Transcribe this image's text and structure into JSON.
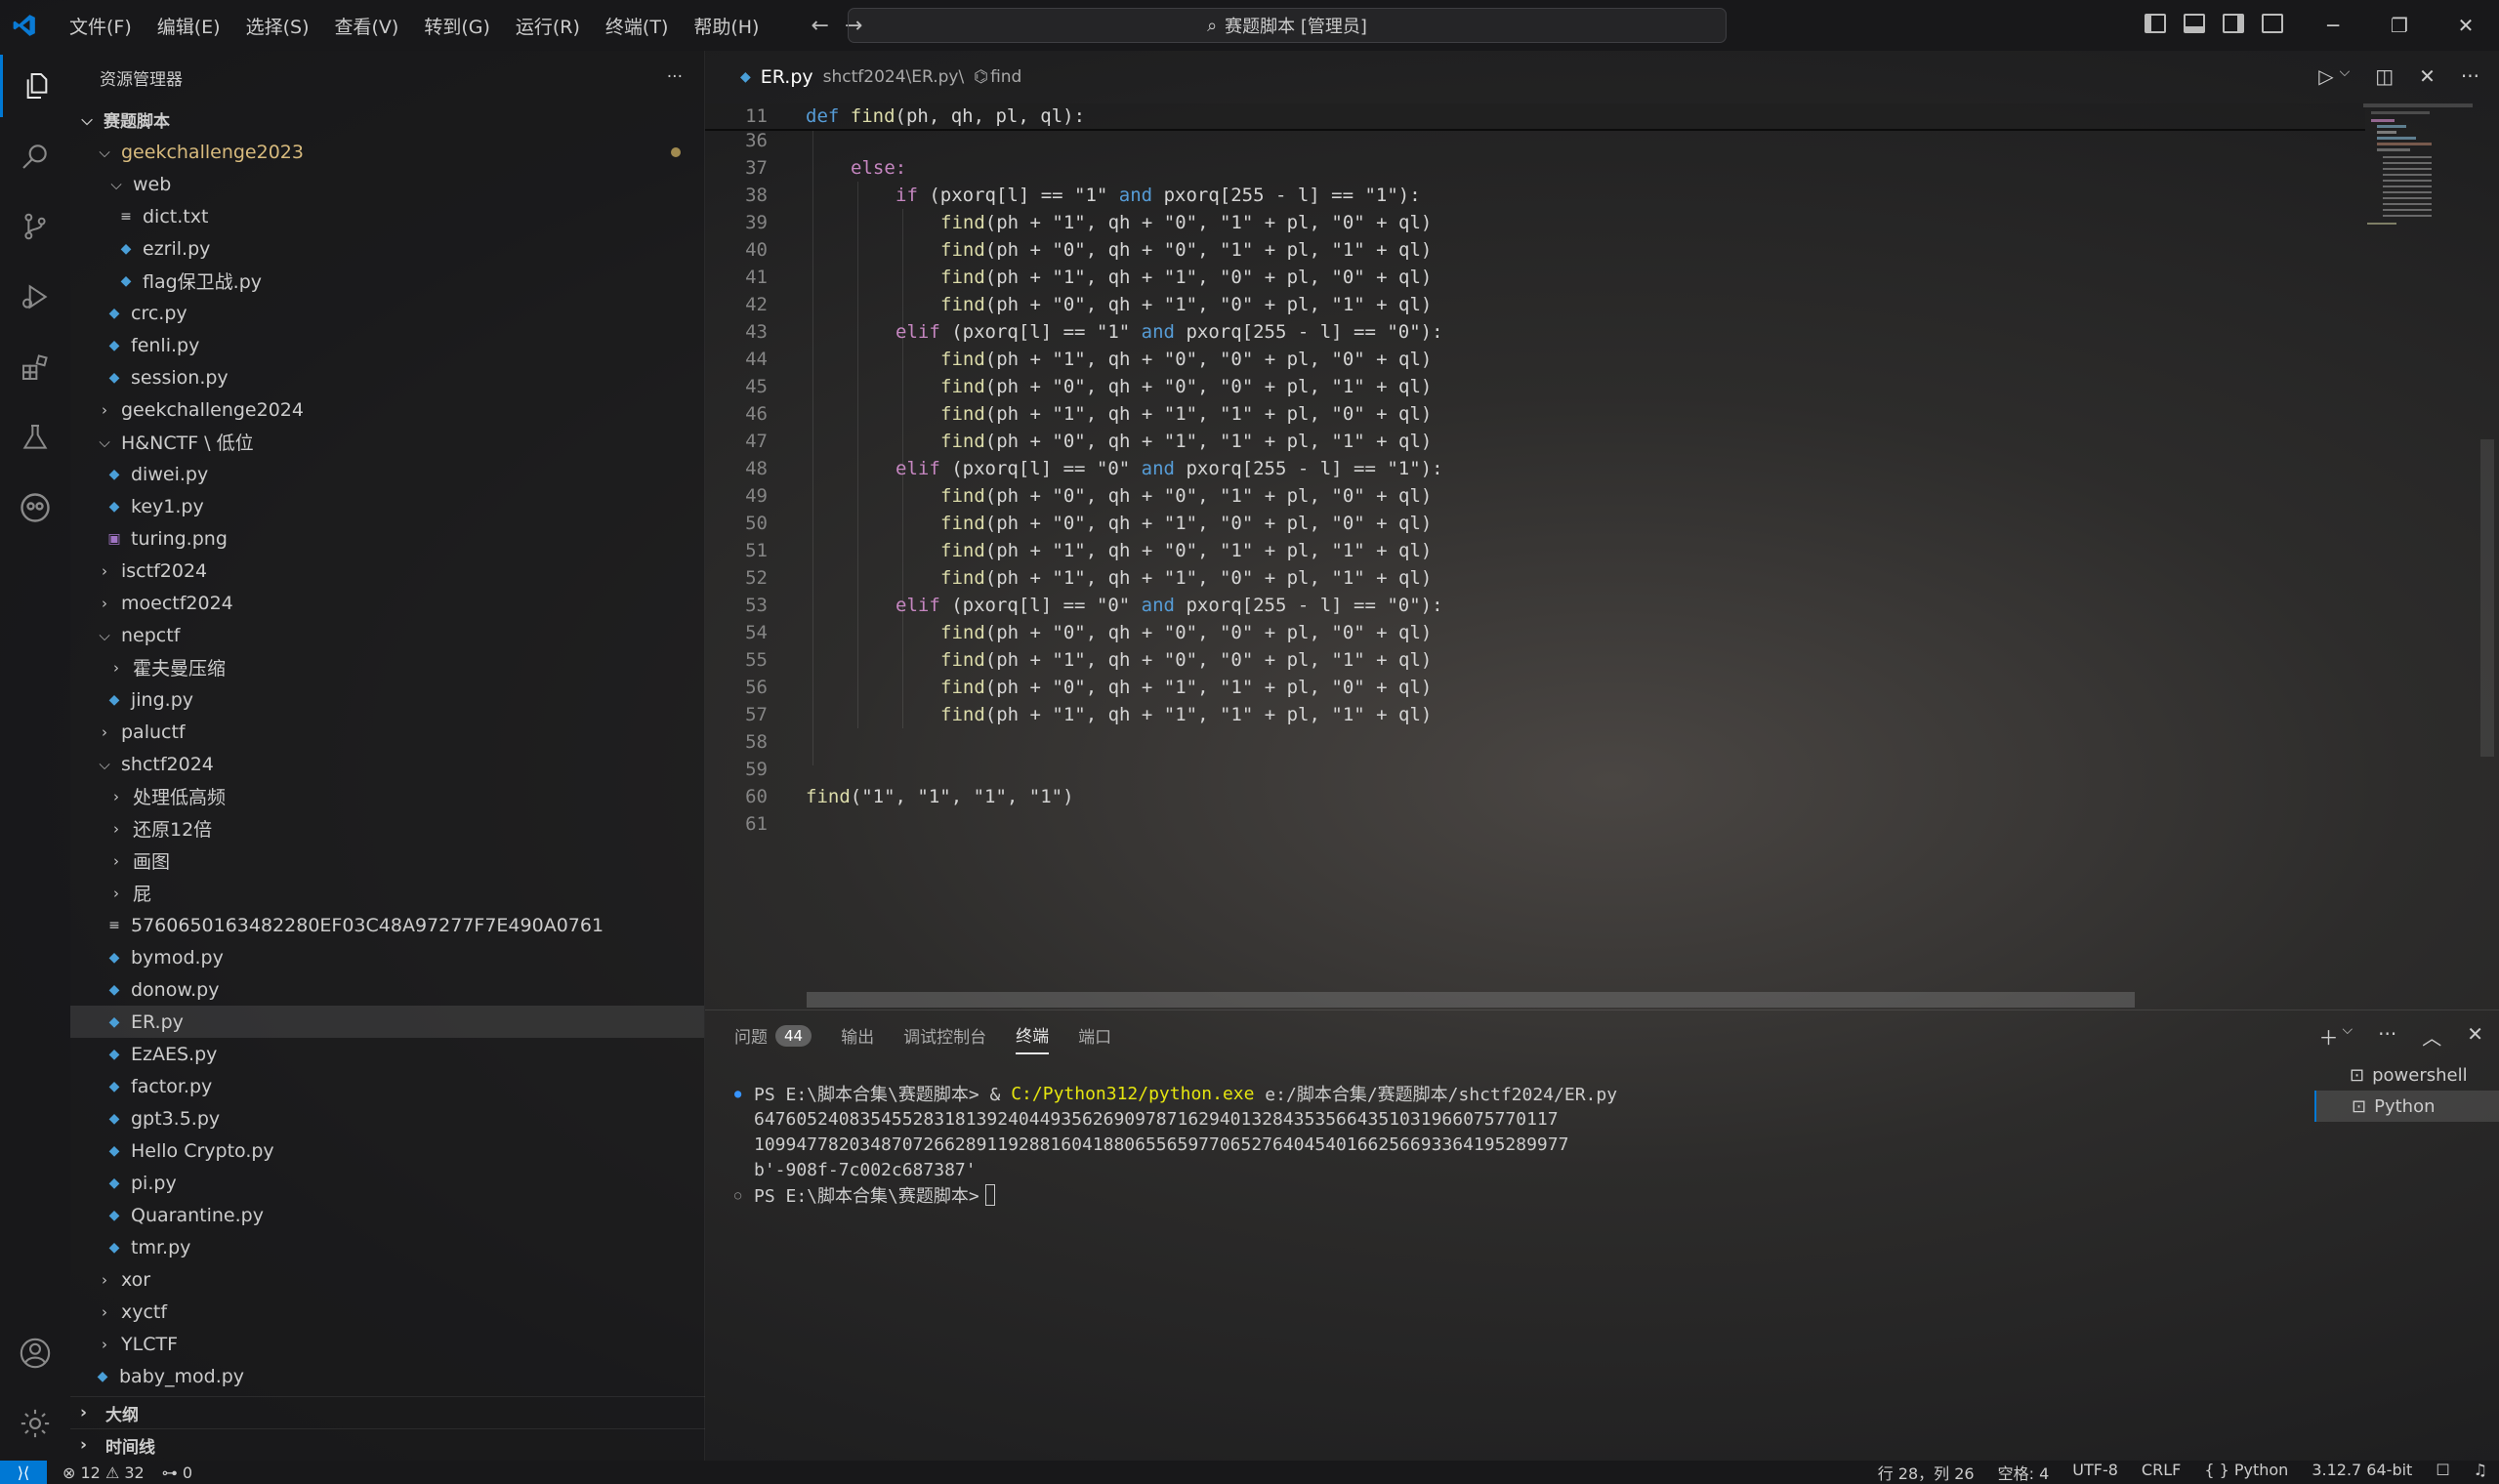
{
  "titlebar": {
    "menu": [
      "文件(F)",
      "编辑(E)",
      "选择(S)",
      "查看(V)",
      "转到(G)",
      "运行(R)",
      "终端(T)",
      "帮助(H)"
    ],
    "search_text": "赛题脚本 [管理员]"
  },
  "sidebar": {
    "title": "资源管理器",
    "more": "···",
    "root": "赛题脚本",
    "items": [
      {
        "label": "geekchallenge2023"
      },
      {
        "label": "web"
      },
      {
        "label": "dict.txt"
      },
      {
        "label": "ezril.py"
      },
      {
        "label": "flag保卫战.py"
      },
      {
        "label": "crc.py"
      },
      {
        "label": "fenli.py"
      },
      {
        "label": "session.py"
      },
      {
        "label": "geekchallenge2024"
      },
      {
        "label": "H&NCTF \\ 低位"
      },
      {
        "label": "diwei.py"
      },
      {
        "label": "key1.py"
      },
      {
        "label": "turing.png"
      },
      {
        "label": "isctf2024"
      },
      {
        "label": "moectf2024"
      },
      {
        "label": "nepctf"
      },
      {
        "label": "霍夫曼压缩"
      },
      {
        "label": "jing.py"
      },
      {
        "label": "paluctf"
      },
      {
        "label": "shctf2024"
      },
      {
        "label": "处理低高频"
      },
      {
        "label": "还原12倍"
      },
      {
        "label": "画图"
      },
      {
        "label": "屁"
      },
      {
        "label": "5760650163482280EF03C48A97277F7E490A0761"
      },
      {
        "label": "bymod.py"
      },
      {
        "label": "donow.py"
      },
      {
        "label": "ER.py"
      },
      {
        "label": "EzAES.py"
      },
      {
        "label": "factor.py"
      },
      {
        "label": "gpt3.5.py"
      },
      {
        "label": "Hello Crypto.py"
      },
      {
        "label": "pi.py"
      },
      {
        "label": "Quarantine.py"
      },
      {
        "label": "tmr.py"
      },
      {
        "label": "xor"
      },
      {
        "label": "xyctf"
      },
      {
        "label": "YLCTF"
      },
      {
        "label": "baby_mod.py"
      }
    ],
    "outline": "大纲",
    "timeline": "时间线"
  },
  "editor": {
    "tab_name": "ER.py",
    "breadcrumb_path": "shctf2024\\ER.py\\",
    "breadcrumb_symbol": "find",
    "line_numbers": [
      "11",
      "36",
      "37",
      "38",
      "39",
      "40",
      "41",
      "42",
      "43",
      "44",
      "45",
      "46",
      "47",
      "48",
      "49",
      "50",
      "51",
      "52",
      "53",
      "54",
      "55",
      "56",
      "57",
      "58",
      "59",
      "60",
      "61"
    ],
    "code": {
      "l11_def": "def",
      "l11_name": "find",
      "l11_params": "(ph, qh, pl, ql):",
      "l37": "else:",
      "l38_kw": "if",
      "l38_a": " (pxorq[l] == \"1\" ",
      "l38_and": "and",
      "l38_b": " pxorq[255 - l] == \"1\"):",
      "l43_kw": "elif",
      "l43_a": " (pxorq[l] == \"1\" ",
      "l43_and": "and",
      "l43_b": " pxorq[255 - l] == \"0\"):",
      "l48_kw": "elif",
      "l48_a": " (pxorq[l] == \"0\" ",
      "l48_and": "and",
      "l48_b": " pxorq[255 - l] == \"1\"):",
      "l53_kw": "elif",
      "l53_a": " (pxorq[l] == \"0\" ",
      "l53_and": "and",
      "l53_b": " pxorq[255 - l] == \"0\"):",
      "calls": [
        "(ph + \"1\", qh + \"0\", \"1\" + pl, \"0\" + ql)",
        "(ph + \"0\", qh + \"0\", \"1\" + pl, \"1\" + ql)",
        "(ph + \"1\", qh + \"1\", \"0\" + pl, \"0\" + ql)",
        "(ph + \"0\", qh + \"1\", \"0\" + pl, \"1\" + ql)",
        "(ph + \"1\", qh + \"0\", \"0\" + pl, \"0\" + ql)",
        "(ph + \"0\", qh + \"0\", \"0\" + pl, \"1\" + ql)",
        "(ph + \"1\", qh + \"1\", \"1\" + pl, \"0\" + ql)",
        "(ph + \"0\", qh + \"1\", \"1\" + pl, \"1\" + ql)",
        "(ph + \"0\", qh + \"0\", \"1\" + pl, \"0\" + ql)",
        "(ph + \"0\", qh + \"1\", \"0\" + pl, \"0\" + ql)",
        "(ph + \"1\", qh + \"0\", \"1\" + pl, \"1\" + ql)",
        "(ph + \"1\", qh + \"1\", \"0\" + pl, \"1\" + ql)",
        "(ph + \"0\", qh + \"0\", \"0\" + pl, \"0\" + ql)",
        "(ph + \"1\", qh + \"0\", \"0\" + pl, \"1\" + ql)",
        "(ph + \"0\", qh + \"1\", \"1\" + pl, \"0\" + ql)",
        "(ph + \"1\", qh + \"1\", \"1\" + pl, \"1\" + ql)"
      ],
      "call_fn": "find",
      "l60_fn": "find",
      "l60_args": "(\"1\", \"1\", \"1\", \"1\")"
    }
  },
  "panel": {
    "tabs": [
      "问题",
      "输出",
      "调试控制台",
      "终端",
      "端口"
    ],
    "problems_count": "44",
    "terminal": {
      "prompt": "PS E:\\脚本合集\\赛题脚本> & ",
      "exe": "C:/Python312/python.exe",
      "script": " e:/脚本合集/赛题脚本/shctf2024/ER.py",
      "out1": "6476052408354552831813924044935626909787162940132843535664351031966075770117",
      "out2": "10994778203487072662891192881604188065565977065276404540166256693364195289977",
      "out3": "b'-908f-7c002c687387'",
      "prompt2": "PS E:\\脚本合集\\赛题脚本>"
    },
    "terminals": [
      "powershell",
      "Python"
    ]
  },
  "statusbar": {
    "errors": "12",
    "warnings": "32",
    "ports": "0",
    "position": "行 28，列 26",
    "spaces": "空格: 4",
    "encoding": "UTF-8",
    "eol": "CRLF",
    "language": "Python",
    "interpreter": "3.12.7 64-bit"
  },
  "colors": {
    "accent": "#0078d4",
    "python_icon": "#4a9fd8",
    "modified": "#d7ba7d"
  }
}
